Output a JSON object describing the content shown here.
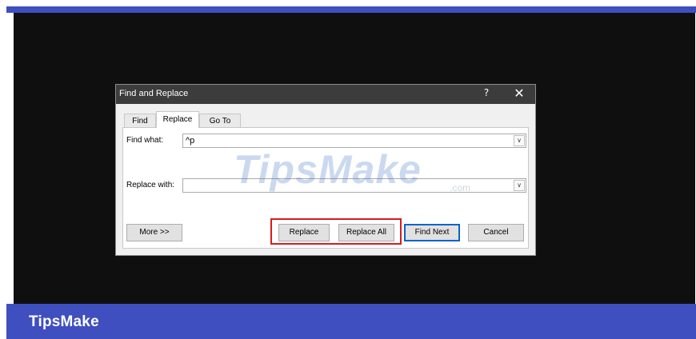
{
  "dialog": {
    "title": "Find and Replace",
    "help_glyph": "?",
    "close_glyph": "✕",
    "tabs": [
      {
        "label": "Find"
      },
      {
        "label": "Replace"
      },
      {
        "label": "Go To"
      }
    ],
    "find_label": "Find what:",
    "find_value": "^p",
    "replace_label": "Replace with:",
    "replace_value": "",
    "dropdown_glyph": "∨",
    "buttons": {
      "more": "More >>",
      "replace": "Replace",
      "replace_all": "Replace All",
      "find_next": "Find Next",
      "cancel": "Cancel"
    },
    "highlight_color": "#d81c1c"
  },
  "watermark": {
    "text": "TipsMake",
    "suffix": ".com"
  },
  "footer": {
    "brand": "TipsMake",
    "bar_color": "#3f4fc0"
  }
}
